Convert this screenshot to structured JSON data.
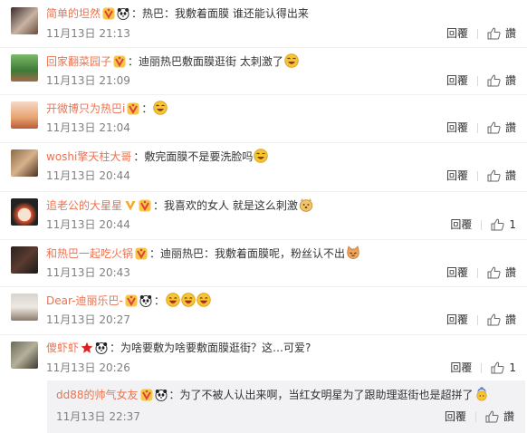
{
  "comments": [
    {
      "username": "简单的坦然",
      "badges": [
        "vip",
        "panda"
      ],
      "text": "热巴：我敷着面膜 谁还能认得出来",
      "emojis": [],
      "time": "11月13日 21:13",
      "reply": "回覆",
      "like_label": "讚",
      "like_count": ""
    },
    {
      "username": "回家翻菜园子",
      "badges": [
        "vip"
      ],
      "text": "迪丽热巴敷面膜逛街 太刺激了",
      "emojis": [
        "laugh-cry-emoji"
      ],
      "time": "11月13日 21:09",
      "reply": "回覆",
      "like_label": "讚",
      "like_count": ""
    },
    {
      "username": "开微博只为热巴i",
      "badges": [
        "vip"
      ],
      "text": "",
      "emojis": [
        "laugh-cry-emoji"
      ],
      "time": "11月13日 21:04",
      "reply": "回覆",
      "like_label": "讚",
      "like_count": ""
    },
    {
      "username": "woshi擎天柱大哥",
      "badges": [],
      "text": "敷完面膜不是要洗脸吗",
      "emojis": [
        "laugh-cry-emoji"
      ],
      "time": "11月13日 20:44",
      "reply": "回覆",
      "like_label": "讚",
      "like_count": ""
    },
    {
      "username": "追老公的大星星",
      "badges": [
        "verified-v",
        "vip"
      ],
      "text": "我喜欢的女人 就是这么刺激",
      "emojis": [
        "doge-emoji"
      ],
      "time": "11月13日 20:44",
      "reply": "回覆",
      "like_label": "",
      "like_count": "1"
    },
    {
      "username": "和热巴一起吃火锅",
      "badges": [
        "vip"
      ],
      "text": "迪丽热巴：我敷着面膜呢，粉丝认不出",
      "emojis": [
        "cat-emoji"
      ],
      "time": "11月13日 20:43",
      "reply": "回覆",
      "like_label": "讚",
      "like_count": ""
    },
    {
      "username": "Dear-迪丽乐巴-",
      "badges": [
        "vip",
        "panda"
      ],
      "text": "",
      "emojis": [
        "laugh-emoji",
        "laugh-emoji",
        "laugh-emoji"
      ],
      "time": "11月13日 20:27",
      "reply": "回覆",
      "like_label": "讚",
      "like_count": ""
    },
    {
      "username": "傻虾虾",
      "badges": [
        "star",
        "panda"
      ],
      "text": "为啥要敷为啥要敷面膜逛街？这…可爱?",
      "emojis": [],
      "time": "11月13日 20:26",
      "reply": "回覆",
      "like_label": "",
      "like_count": "1"
    }
  ],
  "subreply": {
    "username": "dd88的帅气女友",
    "badges": [
      "vip",
      "panda"
    ],
    "text": "为了不被人认出来啊，当红女明星为了跟助理逛街也是超拼了",
    "emojis": [
      "hair-emoji"
    ],
    "time": "11月13日 22:37",
    "reply": "回覆",
    "like_label": "讚",
    "like_count": ""
  },
  "colors": {
    "username": "#eb7350",
    "subusername": "#eb7350",
    "time": "#808080",
    "subbox_bg": "#f2f2f5"
  }
}
